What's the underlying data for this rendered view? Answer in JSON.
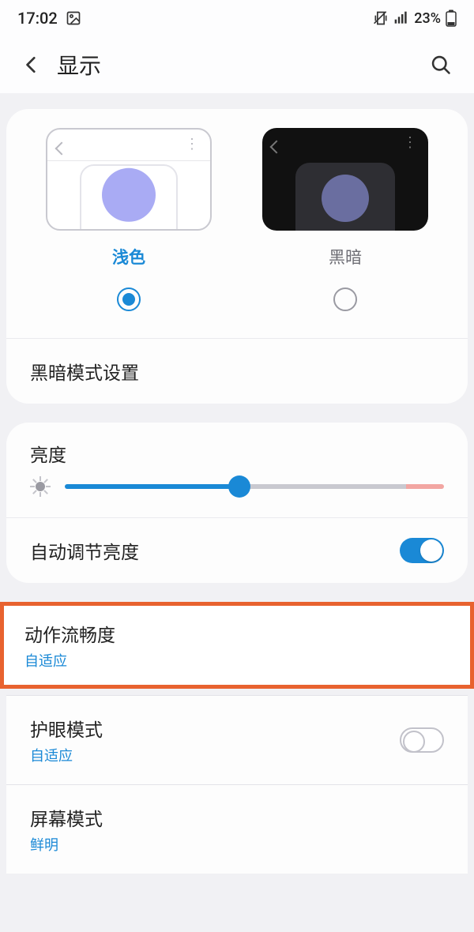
{
  "status": {
    "time": "17:02",
    "battery": "23%"
  },
  "header": {
    "title": "显示"
  },
  "theme": {
    "light_label": "浅色",
    "dark_label": "黑暗",
    "dark_settings": "黑暗模式设置"
  },
  "brightness": {
    "label": "亮度",
    "auto_label": "自动调节亮度",
    "value_percent": 46
  },
  "motion": {
    "label": "动作流畅度",
    "value": "自适应"
  },
  "eye": {
    "label": "护眼模式",
    "value": "自适应"
  },
  "screen_mode": {
    "label": "屏幕模式",
    "value": "鲜明"
  }
}
